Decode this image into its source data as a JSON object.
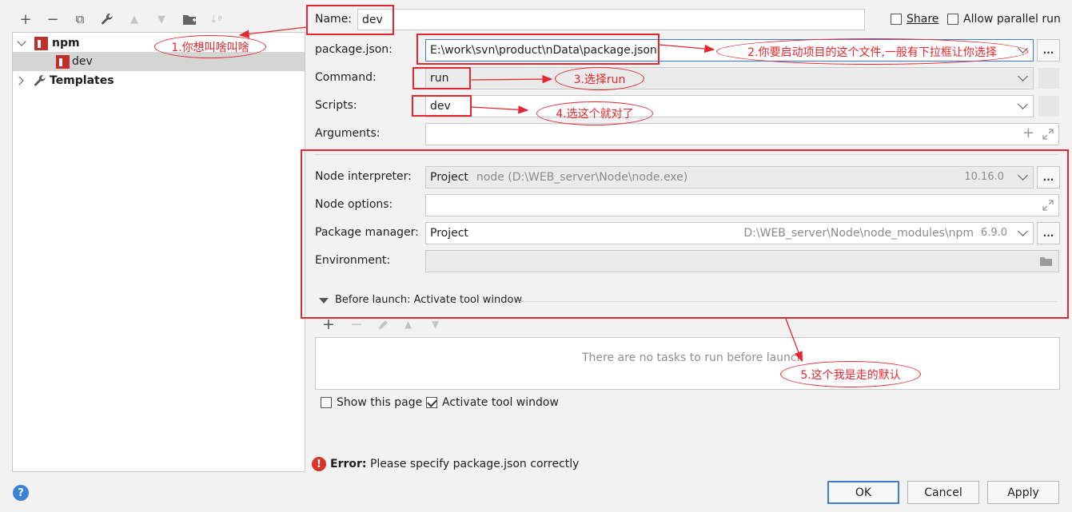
{
  "toolbar": {
    "add": "+",
    "remove": "−",
    "copy": "⧉",
    "edit": "🔧",
    "up": "▲",
    "down": "▼",
    "folder": "📁",
    "sort": "↓ª"
  },
  "tree": {
    "npm_label": "npm",
    "dev_label": "dev",
    "templates_label": "Templates"
  },
  "top": {
    "name_label": "Name:",
    "name_value": "dev",
    "share_label": "Share",
    "parallel_label": "Allow parallel run"
  },
  "form": {
    "package_label": "package.json:",
    "package_value": "E:\\work\\svn\\product\\nData\\package.json",
    "command_label": "Command:",
    "command_value": "run",
    "scripts_label": "Scripts:",
    "scripts_value": "dev",
    "arguments_label": "Arguments:",
    "node_interp_label": "Node interpreter:",
    "node_interp_project": "Project",
    "node_interp_path": "node (D:\\WEB_server\\Node\\node.exe)",
    "node_interp_version": "10.16.0",
    "node_options_label": "Node options:",
    "pkg_mgr_label": "Package manager:",
    "pkg_mgr_value": "Project",
    "pkg_mgr_path": "D:\\WEB_server\\Node\\node_modules\\npm",
    "pkg_mgr_version": "6.9.0",
    "env_label": "Environment:"
  },
  "before_launch": {
    "title": "Before launch: Activate tool window",
    "empty": "There are no tasks to run before launch"
  },
  "options": {
    "show_page": "Show this page",
    "activate": "Activate tool window"
  },
  "error": {
    "bold": "Error:",
    "text": " Please specify package.json correctly"
  },
  "buttons": {
    "ok": "OK",
    "cancel": "Cancel",
    "apply": "Apply",
    "help": "?",
    "dots": "..."
  },
  "annotations": {
    "a1": "1.你想叫啥叫啥",
    "a2": "2.你要启动项目的这个文件,一般有下拉框让你选择",
    "a3": "3.选择run",
    "a4": "4.选这个就对了",
    "a5": "5.这个我是走的默认"
  },
  "colors": {
    "annotation": "#e5262d",
    "ok_border": "#3d7bd9",
    "error": "#d8342c"
  }
}
